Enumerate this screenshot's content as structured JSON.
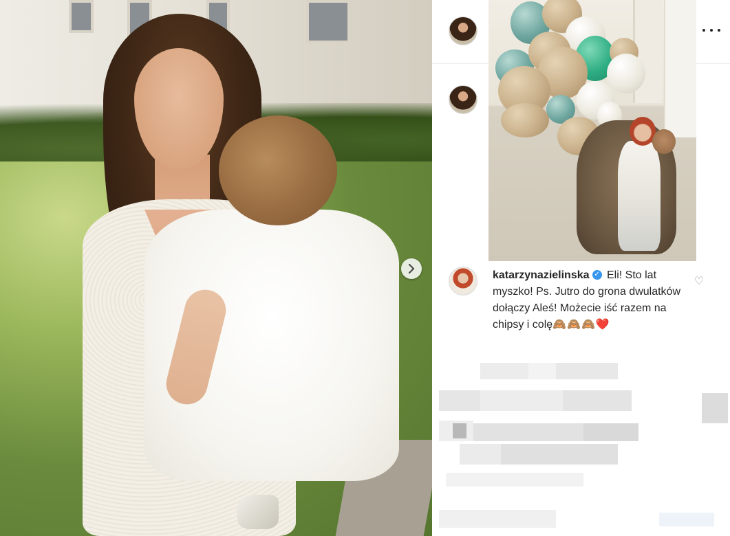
{
  "post": {
    "next_icon": "chevron-right-icon"
  },
  "sidebar": {
    "more_icon": "more-horizontal-icon",
    "comment": {
      "username": "katarzynazielinska",
      "verified_icon": "verified-badge-icon",
      "verified_glyph": "✓",
      "text": "Eli! Sto lat myszko! Ps. Jutro do grona dwulatków dołączy Aleś! Możecie iść razem na chipsy i colę",
      "emojis": "🙈🙈🙈❤️",
      "like_icon": "heart-outline-icon",
      "like_glyph": "♡"
    }
  },
  "colors": {
    "verified": "#3897f0",
    "text": "#262626",
    "icon_gray": "#8e8e8e"
  }
}
